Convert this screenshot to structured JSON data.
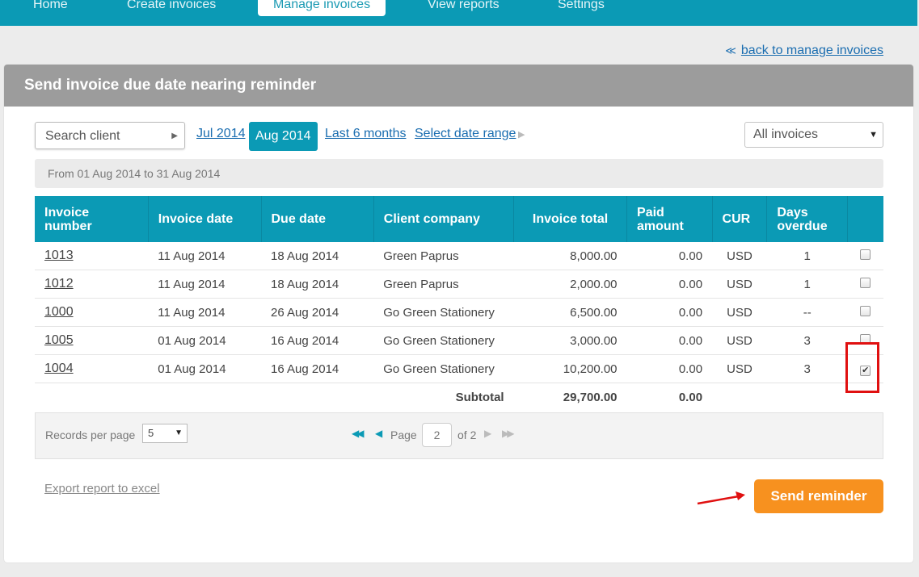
{
  "nav": {
    "items": [
      {
        "label": "Home"
      },
      {
        "label": "Create invoices"
      },
      {
        "label": "Manage invoices",
        "active": true
      },
      {
        "label": "View reports"
      },
      {
        "label": "Settings"
      }
    ]
  },
  "back_link": {
    "chevron": "≪",
    "label": "back to manage invoices"
  },
  "page_title": "Send invoice due date nearing reminder",
  "filters": {
    "search_placeholder": "Search client",
    "periods": [
      {
        "label": "Jul 2014"
      },
      {
        "label": "Aug 2014",
        "active": true
      },
      {
        "label": "Last 6 months"
      },
      {
        "label": "Select date range"
      }
    ],
    "invoice_filter": "All invoices"
  },
  "date_range_text": "From 01 Aug 2014 to 31 Aug 2014",
  "table": {
    "headers": [
      "Invoice number",
      "Invoice date",
      "Due date",
      "Client company",
      "Invoice total",
      "Paid amount",
      "CUR",
      "Days overdue",
      ""
    ],
    "rows": [
      {
        "number": "1013",
        "invoice_date": "11 Aug 2014",
        "due_date": "18 Aug 2014",
        "client": "Green Paprus",
        "total": "8,000.00",
        "paid": "0.00",
        "cur": "USD",
        "overdue": "1",
        "checked": false
      },
      {
        "number": "1012",
        "invoice_date": "11 Aug 2014",
        "due_date": "18 Aug 2014",
        "client": "Green Paprus",
        "total": "2,000.00",
        "paid": "0.00",
        "cur": "USD",
        "overdue": "1",
        "checked": false
      },
      {
        "number": "1000",
        "invoice_date": "11 Aug 2014",
        "due_date": "26 Aug 2014",
        "client": "Go Green Stationery",
        "total": "6,500.00",
        "paid": "0.00",
        "cur": "USD",
        "overdue": "--",
        "checked": false
      },
      {
        "number": "1005",
        "invoice_date": "01 Aug 2014",
        "due_date": "16 Aug 2014",
        "client": "Go Green Stationery",
        "total": "3,000.00",
        "paid": "0.00",
        "cur": "USD",
        "overdue": "3",
        "checked": false
      },
      {
        "number": "1004",
        "invoice_date": "01 Aug 2014",
        "due_date": "16 Aug 2014",
        "client": "Go Green Stationery",
        "total": "10,200.00",
        "paid": "0.00",
        "cur": "USD",
        "overdue": "3",
        "checked": true
      }
    ],
    "subtotal": {
      "label": "Subtotal",
      "total": "29,700.00",
      "paid": "0.00"
    }
  },
  "pagination": {
    "records_label": "Records per page",
    "records_value": "5",
    "page_label": "Page",
    "page_value": "2",
    "of_label": "of 2"
  },
  "export_label": "Export report to excel",
  "send_button": "Send reminder",
  "colors": {
    "accent": "#0b9ab5",
    "action": "#f7911f",
    "highlight": "#e01010"
  }
}
